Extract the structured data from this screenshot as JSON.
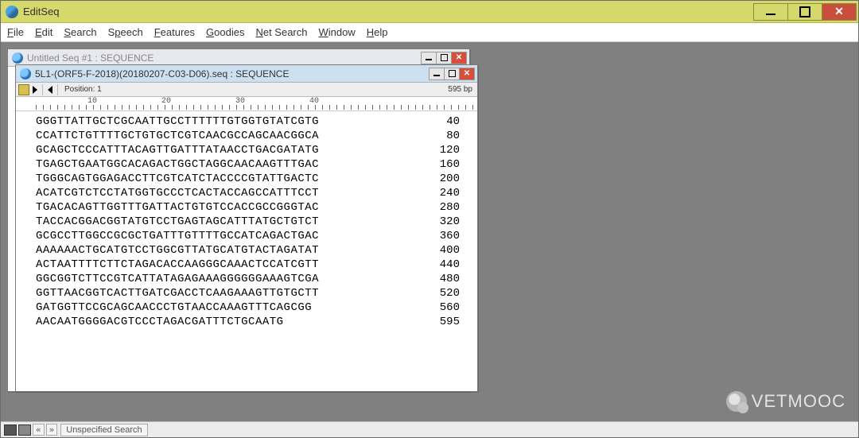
{
  "app": {
    "title": "EditSeq"
  },
  "menubar": [
    {
      "label": "File",
      "u": "F"
    },
    {
      "label": "Edit",
      "u": "E"
    },
    {
      "label": "Search",
      "u": "S"
    },
    {
      "label": "Speech",
      "u": "S"
    },
    {
      "label": "Features",
      "u": "F"
    },
    {
      "label": "Goodies",
      "u": "G"
    },
    {
      "label": "Net Search",
      "u": "N"
    },
    {
      "label": "Window",
      "u": "W"
    },
    {
      "label": "Help",
      "u": "H"
    }
  ],
  "bg_window": {
    "title": "Untitled Seq #1 : SEQUENCE"
  },
  "doc": {
    "title": "5L1-(ORF5-F-2018)(20180207-C03-D06).seq : SEQUENCE",
    "position_label": "Position: 1",
    "total_bp": "595 bp",
    "ruler_ticks": [
      10,
      20,
      30,
      40
    ],
    "rows": [
      {
        "seq": "GGGTTATTGCTCGCAATTGCCTTTTTTGTGGTGTATCGTG",
        "n": 40
      },
      {
        "seq": "CCATTCTGTTTTGCTGTGCTCGTCAACGCCAGCAACGGCA",
        "n": 80
      },
      {
        "seq": "GCAGCTCCCATTTACAGTTGATTTATAACCTGACGATATG",
        "n": 120
      },
      {
        "seq": "TGAGCTGAATGGCACAGACTGGCTAGGCAACAAGTTTGAC",
        "n": 160
      },
      {
        "seq": "TGGGCAGTGGAGACCTTCGTCATCTACCCCGTATTGACTC",
        "n": 200
      },
      {
        "seq": "ACATCGTCTCCTATGGTGCCCTCACTACCAGCCATTTCCT",
        "n": 240
      },
      {
        "seq": "TGACACAGTTGGTTTGATTACTGTGTCCACCGCCGGGTAC",
        "n": 280
      },
      {
        "seq": "TACCACGGACGGTATGTCCTGAGTAGCATTTATGCTGTCT",
        "n": 320
      },
      {
        "seq": "GCGCCTTGGCCGCGCTGATTTGTTTTGCCATCAGACTGAC",
        "n": 360
      },
      {
        "seq": "AAAAAACTGCATGTCCTGGCGTTATGCATGTACTAGATAT",
        "n": 400
      },
      {
        "seq": "ACTAATTTTCTTCTAGACACCAAGGGCAAACTCCATCGTT",
        "n": 440
      },
      {
        "seq": "GGCGGTCTTCCGTCATTATAGAGAAAGGGGGGAAAGTCGA",
        "n": 480
      },
      {
        "seq": "GGTTAACGGTCACTTGATCGACCTCAAGAAAGTTGTGCTT",
        "n": 520
      },
      {
        "seq": "GATGGTTCCGCAGCAACCCTGTAACCAAAGTTTCAGCGG",
        "n": 560
      },
      {
        "seq": "AACAATGGGGACGTCCCTAGACGATTTCTGCAATG",
        "n": 595
      }
    ]
  },
  "status": {
    "search_label": "Unspecified Search"
  },
  "watermark": {
    "text": "VETMOOC"
  }
}
